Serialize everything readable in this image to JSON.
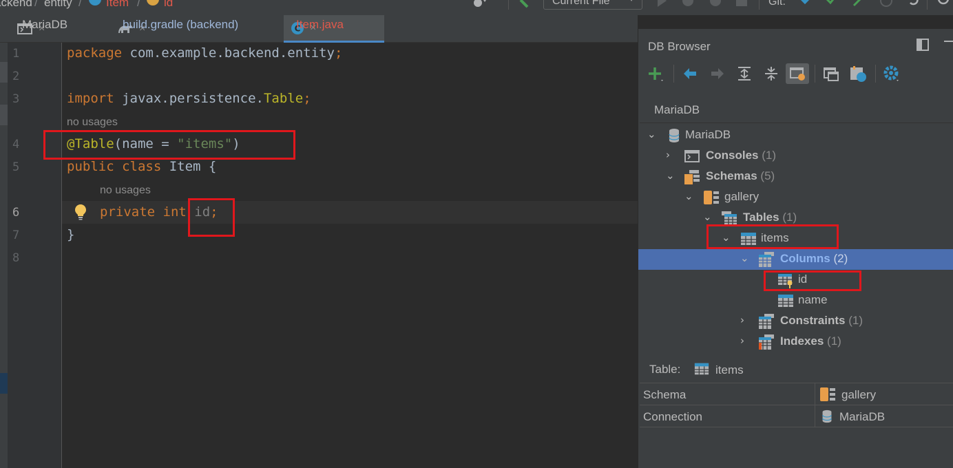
{
  "breadcrumb": {
    "items": [
      "ackend",
      "entity",
      "Item",
      "id"
    ],
    "separator": "/"
  },
  "toolbar": {
    "run_config": "Current File",
    "git_label": "Git:"
  },
  "tabs": [
    {
      "label": "MariaDB",
      "icon": "console-icon",
      "active": false
    },
    {
      "label": "build.gradle (backend)",
      "icon": "gradle-icon",
      "active": false
    },
    {
      "label": "Item.java",
      "icon": "java-class-icon",
      "active": true
    }
  ],
  "tab_close": "×",
  "editor": {
    "line_numbers": [
      "1",
      "2",
      "3",
      "4",
      "5",
      "6",
      "7",
      "8"
    ],
    "current_line": "6",
    "hint_no_usages": "no usages",
    "lines": {
      "l1_kw": "package",
      "l1_rest": " com.example.backend.entity",
      "l1_semi": ";",
      "l3_kw": "import",
      "l3_pkg": " javax.persistence.",
      "l3_cls": "Table",
      "l3_semi": ";",
      "l4_ann": "@Table",
      "l4_open": "(name = ",
      "l4_str": "\"items\"",
      "l4_close": ")",
      "l5_kw": "public class",
      "l5_name": " Item ",
      "l5_brace": "{",
      "l6_kw": "private int",
      "l6_field": " id",
      "l6_semi": ";",
      "l7": "}"
    }
  },
  "db_browser": {
    "title": "DB Browser",
    "connection": "MariaDB",
    "tree": [
      {
        "label": "MariaDB",
        "icon": "database-icon",
        "expanded": true,
        "bold": false
      },
      {
        "label": "Consoles",
        "count": "(1)",
        "icon": "console-icon",
        "expanded": false,
        "bold": true
      },
      {
        "label": "Schemas",
        "count": "(5)",
        "icon": "schemas-icon",
        "expanded": true,
        "bold": true
      },
      {
        "label": "gallery",
        "icon": "schema-icon",
        "expanded": true,
        "bold": false
      },
      {
        "label": "Tables",
        "count": "(1)",
        "icon": "tables-icon",
        "expanded": true,
        "bold": true
      },
      {
        "label": "items",
        "icon": "table-icon",
        "expanded": true,
        "bold": false
      },
      {
        "label": "Columns",
        "count": "(2)",
        "icon": "columns-icon",
        "expanded": true,
        "bold": true,
        "selected": true
      },
      {
        "label": "id",
        "icon": "primary-key-column-icon",
        "bold": false
      },
      {
        "label": "name",
        "icon": "column-icon",
        "bold": false
      },
      {
        "label": "Constraints",
        "count": "(1)",
        "icon": "constraints-icon",
        "expanded": false,
        "bold": true
      },
      {
        "label": "Indexes",
        "count": "(1)",
        "icon": "indexes-icon",
        "expanded": false,
        "bold": true
      }
    ],
    "details": {
      "type_label": "Table:",
      "type_value": "items",
      "rows": [
        {
          "key": "Schema",
          "value": "gallery",
          "icon": "schema-icon"
        },
        {
          "key": "Connection",
          "value": "MariaDB",
          "icon": "database-icon"
        }
      ]
    }
  },
  "colors": {
    "highlight_box": "#e0171c",
    "selection": "#4b6eaf",
    "keyword": "#cc7832",
    "annotation": "#bbb529",
    "string": "#6a8759"
  }
}
